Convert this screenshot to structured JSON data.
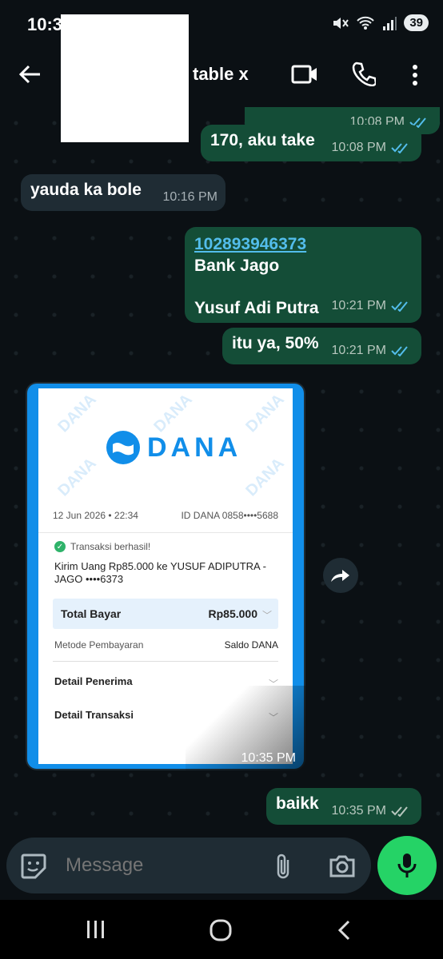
{
  "status_bar": {
    "time": "10:3",
    "battery": "39"
  },
  "header": {
    "contact_name": "table x"
  },
  "messages": [
    {
      "type": "out",
      "text": "",
      "time": "10:08 PM"
    },
    {
      "type": "out",
      "text": "170, aku take",
      "time": "10:08 PM"
    },
    {
      "type": "in",
      "text": "yauda ka bole",
      "time": "10:16 PM"
    },
    {
      "type": "out",
      "link": "102893946373",
      "line2": "Bank Jago",
      "line3": "Yusuf Adi Putra",
      "time": "10:21 PM"
    },
    {
      "type": "out",
      "text": "itu ya, 50%",
      "time": "10:21 PM"
    },
    {
      "type": "out",
      "text": "baikk",
      "time": "10:35 PM"
    }
  ],
  "receipt": {
    "logo": "DANA",
    "date": "12 Jun 2026 • 22:34",
    "id_dana": "ID DANA 0858••••5688",
    "status": "Transaksi berhasil!",
    "description": "Kirim Uang Rp85.000 ke YUSUF ADIPUTRA - JAGO ••••6373",
    "total_label": "Total Bayar",
    "total_value": "Rp85.000",
    "method_label": "Metode Pembayaran",
    "method_value": "Saldo DANA",
    "recipient_detail": "Detail Penerima",
    "transaction_detail": "Detail Transaksi",
    "watermark": "DANA",
    "time": "10:35 PM"
  },
  "input": {
    "placeholder": "Message"
  },
  "colors": {
    "bg": "#0b1014",
    "out_bubble": "#144d37",
    "in_bubble": "#1f2c34",
    "mic": "#25d366",
    "dana_blue": "#118ee9",
    "read_tick": "#53bdeb"
  }
}
